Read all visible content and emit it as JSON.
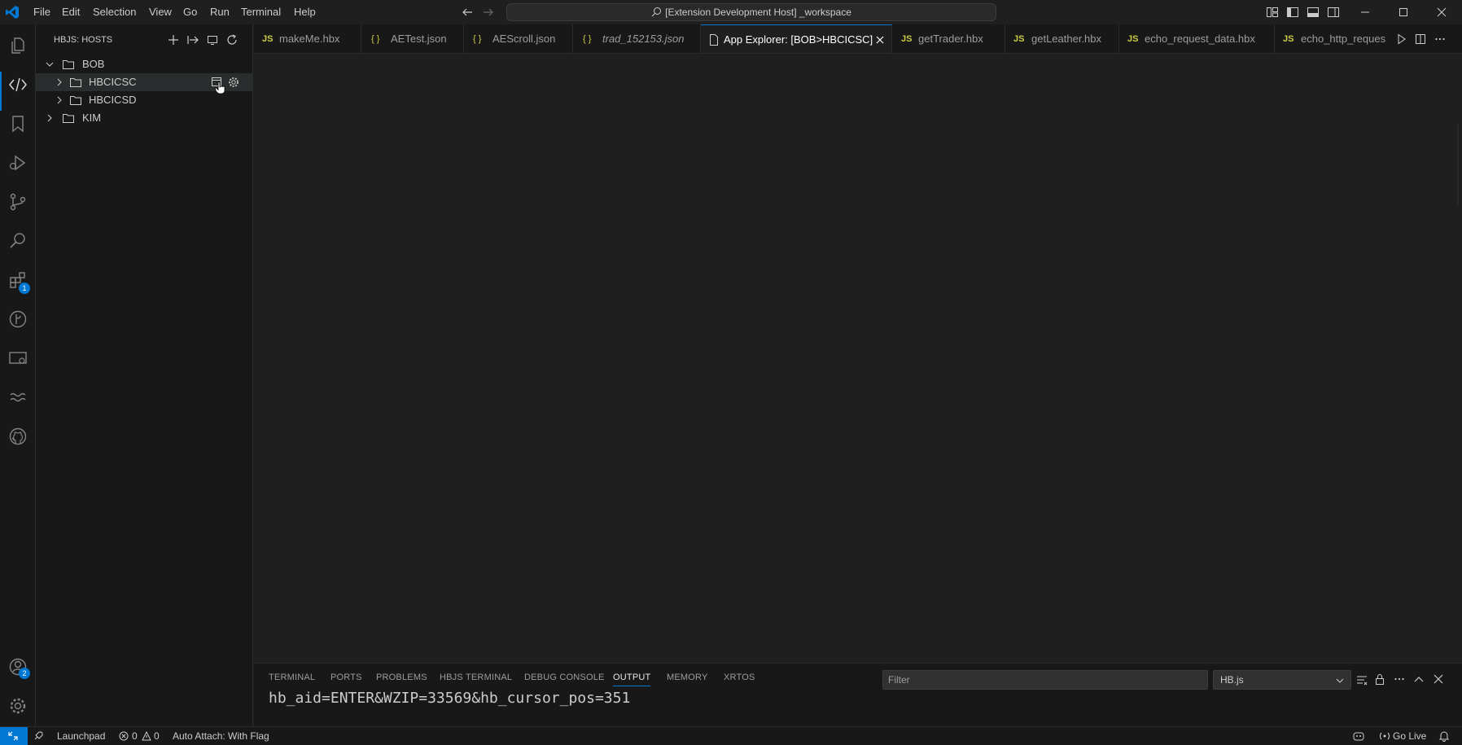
{
  "menu": [
    "File",
    "Edit",
    "Selection",
    "View",
    "Go",
    "Run",
    "Terminal",
    "Help"
  ],
  "command_center": "[Extension Development Host] _workspace",
  "activity_badges": {
    "extensions": "1",
    "accounts": "2"
  },
  "sidebar": {
    "title": "HBJS: HOSTS",
    "tree": [
      {
        "label": "BOB",
        "depth": 0,
        "expanded": true
      },
      {
        "label": "HBCICSC",
        "depth": 1,
        "expanded": false
      },
      {
        "label": "HBCICSD",
        "depth": 1,
        "expanded": false
      },
      {
        "label": "KIM",
        "depth": 0,
        "expanded": false
      }
    ]
  },
  "tabs": [
    {
      "icon": "JS",
      "label": "makeMe.hbx"
    },
    {
      "icon": "{ }",
      "label": "AETest.json"
    },
    {
      "icon": "{ }",
      "label": "AEScroll.json"
    },
    {
      "icon": "{ }",
      "label": "trad_152153.json"
    },
    {
      "icon": "file",
      "label": "App Explorer: [BOB>HBCICSC]"
    },
    {
      "icon": "JS",
      "label": "getTrader.hbx"
    },
    {
      "icon": "JS",
      "label": "getLeather.hbx"
    },
    {
      "icon": "JS",
      "label": "echo_request_data.hbx"
    },
    {
      "icon": "JS",
      "label": "echo_http_reques"
    }
  ],
  "panel": {
    "tabs": [
      "TERMINAL",
      "PORTS",
      "PROBLEMS",
      "HBJS TERMINAL",
      "DEBUG CONSOLE",
      "OUTPUT",
      "MEMORY",
      "XRTOS"
    ],
    "active_tab": "OUTPUT",
    "filter_placeholder": "Filter",
    "channel": "HB.js",
    "output_line": "hb_aid=ENTER&WZIP=33569&hb_cursor_pos=351"
  },
  "status": {
    "launchpad": "Launchpad",
    "errors": "0",
    "warnings": "0",
    "auto_attach": "Auto Attach: With Flag",
    "go_live": "Go Live"
  },
  "colors": {
    "accent": "#0078d4",
    "js_icon": "#cbcb41",
    "json_icon": "#cbcb41"
  }
}
